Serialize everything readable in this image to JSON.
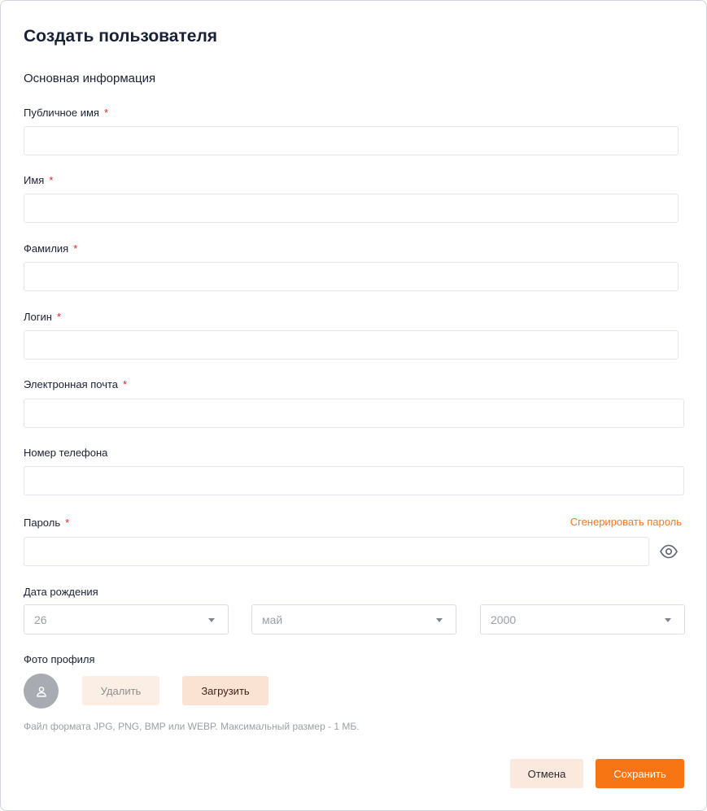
{
  "form": {
    "title": "Создать пользователя",
    "section_title": "Основная информация",
    "required_mark": "*",
    "fields": {
      "public_name": {
        "label": "Публичное имя",
        "value": ""
      },
      "first_name": {
        "label": "Имя",
        "value": ""
      },
      "last_name": {
        "label": "Фамилия",
        "value": ""
      },
      "login": {
        "label": "Логин",
        "value": ""
      },
      "email": {
        "label": "Электронная почта",
        "value": ""
      },
      "phone": {
        "label": "Номер телефона",
        "value": ""
      },
      "password": {
        "label": "Пароль",
        "value": "",
        "generate_link": "Сгенерировать пароль"
      }
    },
    "birth_date": {
      "label": "Дата рождения",
      "day": "26",
      "month": "май",
      "year": "2000"
    },
    "photo": {
      "label": "Фото профиля",
      "delete_label": "Удалить",
      "upload_label": "Загрузить",
      "hint": "Файл формата JPG, PNG, BMP или WEBP. Максимальный размер - 1 МБ."
    },
    "actions": {
      "cancel_label": "Отмена",
      "save_label": "Сохранить"
    }
  },
  "colors": {
    "accent": "#f77613",
    "link": "#f07a2a",
    "required": "#e5232d"
  },
  "icons": {
    "password_toggle": "eye-icon",
    "avatar_placeholder": "user-icon"
  }
}
